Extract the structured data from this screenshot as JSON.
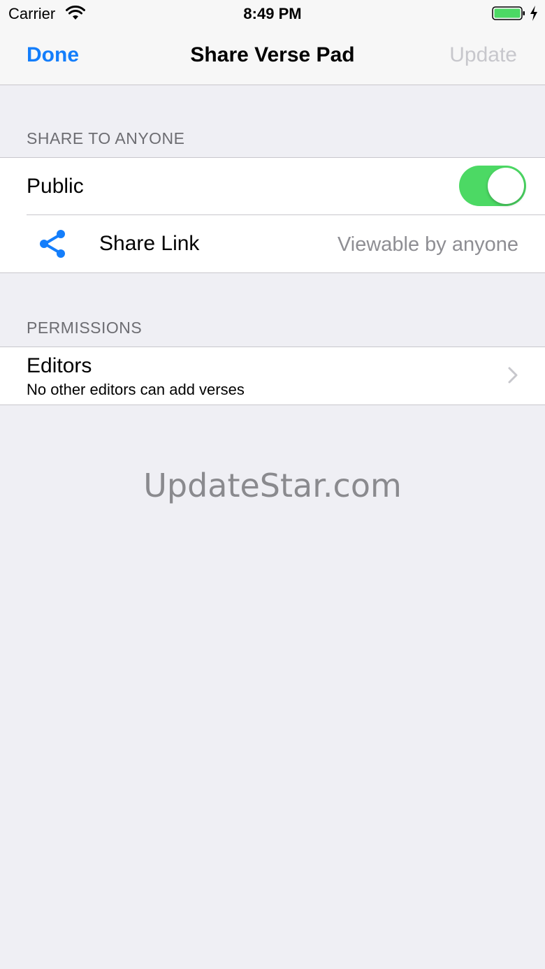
{
  "status_bar": {
    "carrier": "Carrier",
    "time": "8:49 PM",
    "wifi_icon": "wifi-icon",
    "battery_icon": "battery-charging-icon",
    "battery_color": "#4cd964"
  },
  "nav": {
    "left_button": "Done",
    "title": "Share Verse Pad",
    "right_button": "Update",
    "accent_color": "#147efb"
  },
  "sections": {
    "share": {
      "header": "SHARE TO ANYONE",
      "public_label": "Public",
      "public_enabled": true,
      "share_icon": "share-icon",
      "share_label": "Share Link",
      "share_value": "Viewable by anyone"
    },
    "permissions": {
      "header": "PERMISSIONS",
      "editors_title": "Editors",
      "editors_subtitle": "No other editors can add verses",
      "chevron_icon": "chevron-right-icon"
    }
  },
  "watermark": "UpdateStar.com"
}
